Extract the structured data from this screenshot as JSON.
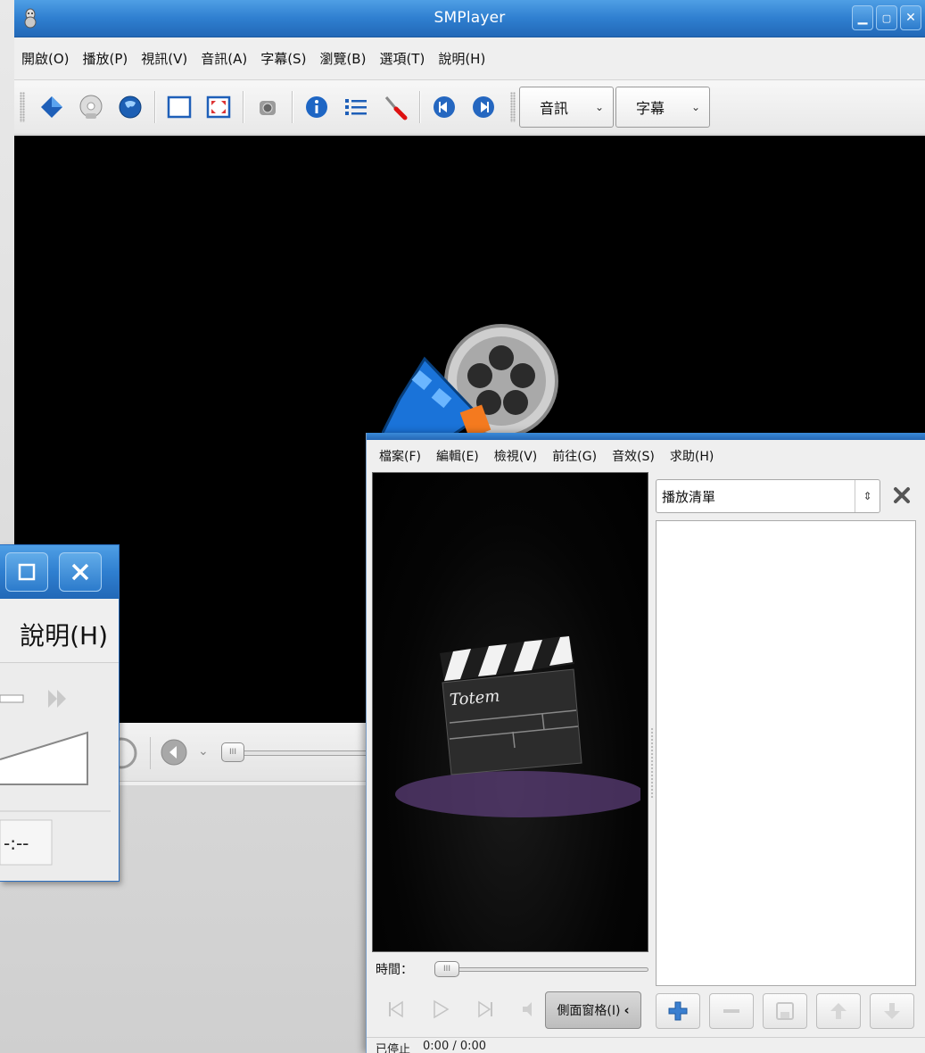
{
  "smplayer": {
    "title": "SMPlayer",
    "menu": [
      "開啟(O)",
      "播放(P)",
      "視訊(V)",
      "音訊(A)",
      "字幕(S)",
      "瀏覽(B)",
      "選項(T)",
      "說明(H)"
    ],
    "audio_combo": "音訊",
    "subtitle_combo": "字幕"
  },
  "mini_window": {
    "menu_fragment": "說明(H)",
    "time_fragment": "-:--"
  },
  "totem": {
    "menu": [
      "檔案(F)",
      "編輯(E)",
      "檢視(V)",
      "前往(G)",
      "音效(S)",
      "求助(H)"
    ],
    "time_label": "時間：",
    "sidebar_button": "側面窗格(I)",
    "playlist_combo": "播放清單",
    "status_state": "已停止",
    "status_time": "0:00 / 0:00",
    "logo_text": "Totem"
  },
  "colors": {
    "titlebar_blue": "#2f7fd0",
    "video_black": "#000000",
    "plus_blue": "#3a7fd0"
  }
}
